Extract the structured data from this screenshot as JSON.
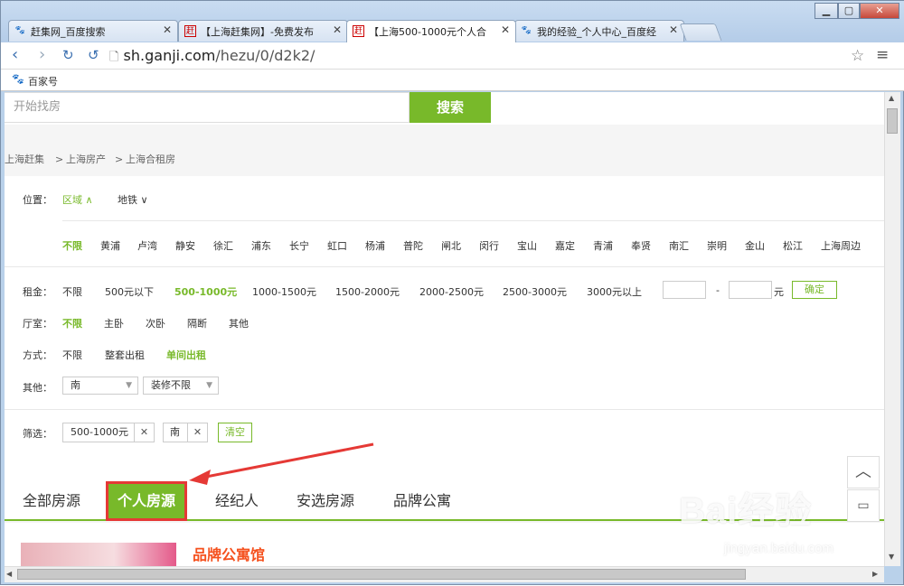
{
  "browser": {
    "tabs": [
      {
        "title": "赶集网_百度搜索",
        "icon": "baidu-paw-icon"
      },
      {
        "title": "【上海赶集网】-免费发布",
        "icon": "ganji-icon"
      },
      {
        "title": "【上海500-1000元个人合",
        "icon": "ganji-icon"
      },
      {
        "title": "我的经验_个人中心_百度经",
        "icon": "baidu-paw-icon"
      }
    ],
    "url_host": "sh.ganji.com",
    "url_path": "/hezu/0/d2k2/",
    "bookmark": "百家号"
  },
  "search": {
    "placeholder": "开始找房",
    "button": "搜索"
  },
  "breadcrumb": {
    "items": [
      "上海赶集",
      "上海房产",
      "上海合租房"
    ],
    "sep": ">"
  },
  "filters": {
    "location": {
      "label": "位置：",
      "modes": [
        "区域",
        "地铁"
      ],
      "districts": [
        "不限",
        "黄浦",
        "卢湾",
        "静安",
        "徐汇",
        "浦东",
        "长宁",
        "虹口",
        "杨浦",
        "普陀",
        "闸北",
        "闵行",
        "宝山",
        "嘉定",
        "青浦",
        "奉贤",
        "南汇",
        "崇明",
        "金山",
        "松江",
        "上海周边"
      ]
    },
    "rent": {
      "label": "租金：",
      "options": [
        "不限",
        "500元以下",
        "500-1000元",
        "1000-1500元",
        "1500-2000元",
        "2000-2500元",
        "2500-3000元",
        "3000元以上"
      ],
      "dash": "-",
      "unit": "元",
      "confirm": "确定"
    },
    "room": {
      "label": "厅室：",
      "options": [
        "不限",
        "主卧",
        "次卧",
        "隔断",
        "其他"
      ]
    },
    "mode": {
      "label": "方式：",
      "options": [
        "不限",
        "整套出租",
        "单间出租"
      ]
    },
    "other": {
      "label": "其他：",
      "orientation": "南",
      "decoration": "装修不限"
    },
    "chosen": {
      "label": "筛选：",
      "chips": [
        "500-1000元",
        "南"
      ],
      "clear": "清空"
    }
  },
  "source_tabs": [
    "全部房源",
    "个人房源",
    "经纪人",
    "安选房源",
    "品牌公寓"
  ],
  "listing": {
    "title": "品牌公寓馆"
  },
  "watermark": {
    "logo": "Bai经验",
    "site": "jingyan.baidu.com"
  },
  "colors": {
    "accent": "#78b92a",
    "highlight": "#e53935",
    "listing_title": "#f5511e"
  }
}
